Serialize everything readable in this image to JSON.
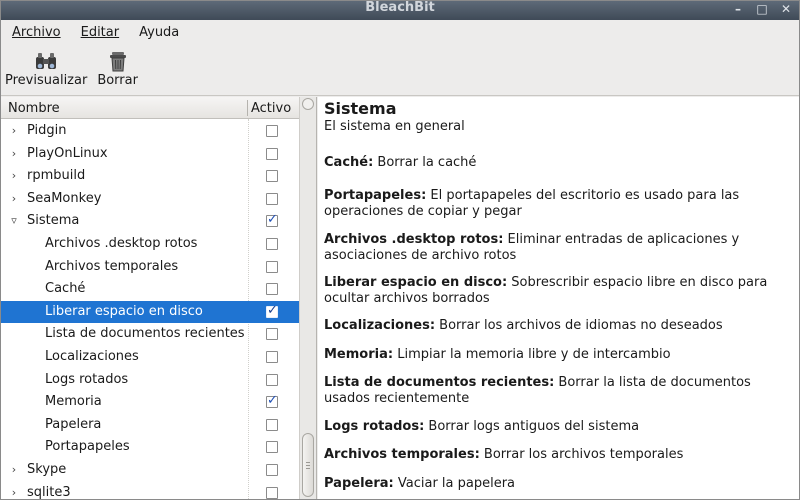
{
  "window": {
    "title": "BleachBit",
    "controls": [
      "minimize-icon",
      "maximize-icon",
      "close-icon"
    ]
  },
  "menubar": {
    "items": [
      {
        "label": "Archivo"
      },
      {
        "label": "Editar"
      },
      {
        "label": "Ayuda"
      }
    ]
  },
  "toolbar": {
    "preview_label": "Previsualizar",
    "preview_icon": "binoculars-icon",
    "delete_label": "Borrar",
    "delete_icon": "trash-icon"
  },
  "tree": {
    "header_name": "Nombre",
    "header_active": "Activo",
    "rows": [
      {
        "label": "Pidgin",
        "level": 0,
        "expander": "collapsed",
        "checked": false,
        "selected": false
      },
      {
        "label": "PlayOnLinux",
        "level": 0,
        "expander": "collapsed",
        "checked": false,
        "selected": false
      },
      {
        "label": "rpmbuild",
        "level": 0,
        "expander": "collapsed",
        "checked": false,
        "selected": false
      },
      {
        "label": "SeaMonkey",
        "level": 0,
        "expander": "collapsed",
        "checked": false,
        "selected": false
      },
      {
        "label": "Sistema",
        "level": 0,
        "expander": "expanded",
        "checked": true,
        "selected": false
      },
      {
        "label": "Archivos .desktop rotos",
        "level": 1,
        "expander": "",
        "checked": false,
        "selected": false
      },
      {
        "label": "Archivos temporales",
        "level": 1,
        "expander": "",
        "checked": false,
        "selected": false
      },
      {
        "label": "Caché",
        "level": 1,
        "expander": "",
        "checked": false,
        "selected": false
      },
      {
        "label": "Liberar espacio en disco",
        "level": 1,
        "expander": "",
        "checked": true,
        "selected": true
      },
      {
        "label": "Lista de documentos recientes",
        "level": 1,
        "expander": "",
        "checked": false,
        "selected": false
      },
      {
        "label": "Localizaciones",
        "level": 1,
        "expander": "",
        "checked": false,
        "selected": false
      },
      {
        "label": "Logs rotados",
        "level": 1,
        "expander": "",
        "checked": false,
        "selected": false
      },
      {
        "label": "Memoria",
        "level": 1,
        "expander": "",
        "checked": true,
        "selected": false
      },
      {
        "label": "Papelera",
        "level": 1,
        "expander": "",
        "checked": false,
        "selected": false
      },
      {
        "label": "Portapapeles",
        "level": 1,
        "expander": "",
        "checked": false,
        "selected": false
      },
      {
        "label": "Skype",
        "level": 0,
        "expander": "collapsed",
        "checked": false,
        "selected": false
      },
      {
        "label": "sqlite3",
        "level": 0,
        "expander": "collapsed",
        "checked": false,
        "selected": false
      }
    ]
  },
  "details": {
    "title": "Sistema",
    "subtitle": "El sistema en general",
    "items": [
      {
        "name": "Caché:",
        "text": " Borrar la caché"
      },
      {
        "name": "Portapapeles:",
        "text": " El portapapeles del escritorio es usado para las operaciones de copiar y pegar"
      },
      {
        "name": "Archivos .desktop rotos:",
        "text": " Eliminar entradas de aplicaciones y asociaciones de archivo rotos"
      },
      {
        "name": "Liberar espacio en disco:",
        "text": " Sobrescribir espacio libre en disco para ocultar archivos borrados"
      },
      {
        "name": "Localizaciones:",
        "text": " Borrar los archivos de idiomas no deseados"
      },
      {
        "name": "Memoria:",
        "text": " Limpiar la memoria libre y de intercambio"
      },
      {
        "name": "Lista de documentos recientes:",
        "text": " Borrar la lista de documentos usados recientemente"
      },
      {
        "name": "Logs rotados:",
        "text": " Borrar logs antiguos del sistema"
      },
      {
        "name": "Archivos temporales:",
        "text": " Borrar los archivos temporales"
      },
      {
        "name": "Papelera:",
        "text": " Vaciar la papelera"
      }
    ]
  },
  "colors": {
    "selection": "#1f74d2",
    "titlebar": "#4a5563"
  }
}
